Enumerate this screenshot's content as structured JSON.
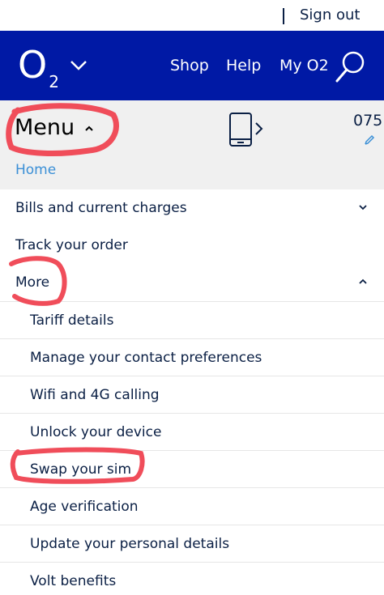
{
  "top_bar": {
    "sign_out": "Sign out"
  },
  "header": {
    "logo_text": "O",
    "logo_sub": "2",
    "nav": [
      "Shop",
      "Help",
      "My O2"
    ]
  },
  "menu_bar": {
    "title": "Menu",
    "number_tail": "075",
    "home": "Home"
  },
  "menu": {
    "items": [
      {
        "label": "Bills and current charges",
        "level": "top",
        "expanded": false
      },
      {
        "label": "Track your order",
        "level": "top"
      },
      {
        "label": "More",
        "level": "top",
        "expanded": true
      }
    ],
    "more_items": [
      "Tariff details",
      "Manage your contact preferences",
      "Wifi and 4G calling",
      "Unlock your device",
      "Swap your sim",
      "Age verification",
      "Update your personal details",
      "Volt benefits"
    ]
  },
  "colors": {
    "brand_blue": "#0019a5",
    "link_blue": "#3a8fd6",
    "annotation_red": "#f04d5a",
    "menu_bg": "#f0f0f0"
  },
  "icons": [
    "chevron-down-icon",
    "search-icon",
    "caret-up-icon",
    "phone-icon",
    "chevron-right-icon",
    "edit-pencil-icon"
  ]
}
